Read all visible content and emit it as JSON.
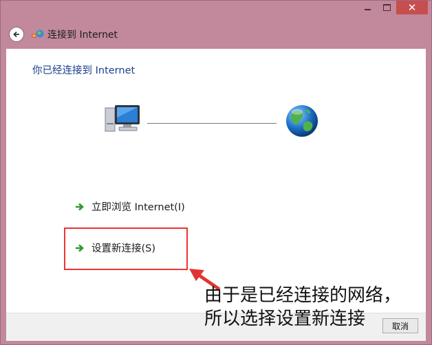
{
  "window": {
    "title": "连接到 Internet",
    "minimize_icon": "minimize-icon",
    "maximize_icon": "maximize-icon",
    "close_icon": "close-icon"
  },
  "main": {
    "heading": "你已经连接到 Internet",
    "links": [
      {
        "label": "立即浏览 Internet(I)",
        "icon": "green-arrow-icon"
      },
      {
        "label": "设置新连接(S)",
        "icon": "green-arrow-icon"
      }
    ]
  },
  "annotation": {
    "text": "由于是已经连接的网络，\n所以选择设置新连接",
    "color": "#e33333"
  },
  "footer": {
    "cancel_label": "取消"
  }
}
